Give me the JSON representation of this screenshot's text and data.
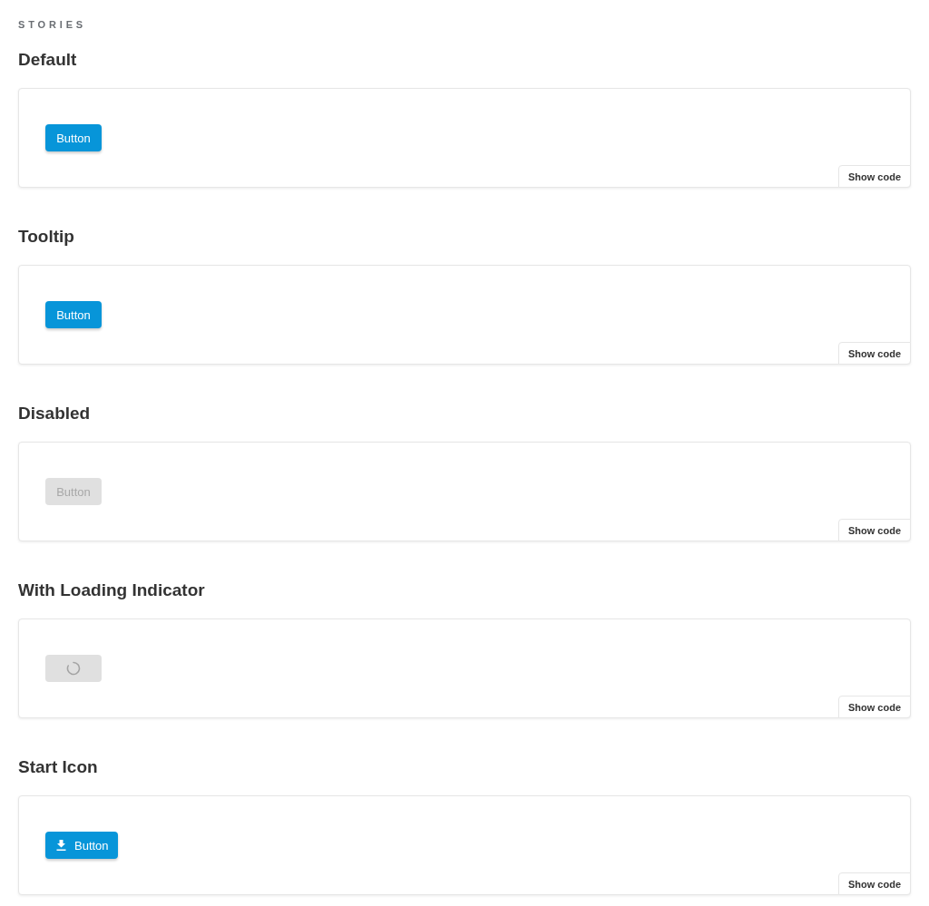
{
  "section_label": "STORIES",
  "stories": [
    {
      "title": "Default",
      "kind": "text",
      "button": {
        "label": "Button",
        "disabled": false
      },
      "show_code": "Show code"
    },
    {
      "title": "Tooltip",
      "kind": "text",
      "button": {
        "label": "Button",
        "disabled": false
      },
      "show_code": "Show code"
    },
    {
      "title": "Disabled",
      "kind": "text",
      "button": {
        "label": "Button",
        "disabled": true
      },
      "show_code": "Show code"
    },
    {
      "title": "With Loading Indicator",
      "kind": "spinner",
      "button": {
        "disabled": true
      },
      "show_code": "Show code"
    },
    {
      "title": "Start Icon",
      "kind": "start_icon",
      "button": {
        "label": "Button",
        "disabled": false
      },
      "show_code": "Show code"
    }
  ]
}
